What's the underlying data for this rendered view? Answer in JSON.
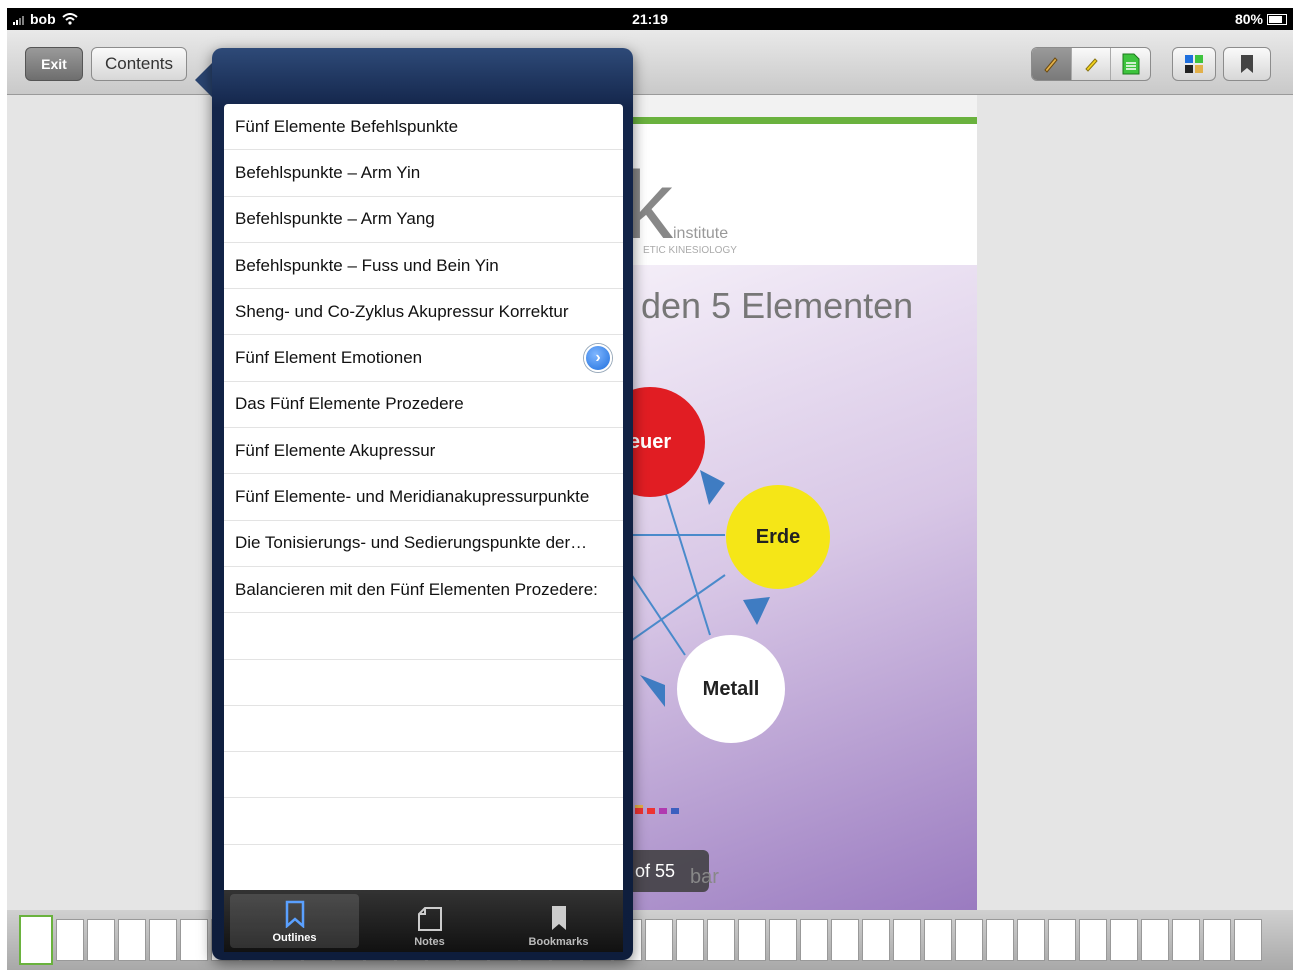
{
  "status_bar": {
    "carrier": "bob",
    "time": "21:19",
    "battery": "80%"
  },
  "toolbar": {
    "exit_label": "Exit",
    "contents_label": "Contents"
  },
  "document": {
    "logo_letter": "k",
    "logo_sub": "institute",
    "logo_tagline": "ETIC KINESIOLOGY",
    "headline": "den 5 Elementen",
    "elements": {
      "fire": "euer",
      "earth": "Erde",
      "metal": "Metall"
    },
    "page_indicator": "of 55",
    "author_fragment": "bar"
  },
  "outline": {
    "items": [
      {
        "label": "Fünf Elemente Befehlspunkte"
      },
      {
        "label": "Befehlspunkte – Arm Yin"
      },
      {
        "label": "Befehlspunkte – Arm Yang"
      },
      {
        "label": "Befehlspunkte – Fuss und Bein Yin"
      },
      {
        "label": "Sheng- und Co-Zyklus Akupressur Korrektur"
      },
      {
        "label": "Fünf Element Emotionen"
      },
      {
        "label": "Das Fünf Elemente Prozedere"
      },
      {
        "label": "Fünf Elemente Akupressur"
      },
      {
        "label": "Fünf Elemente- und Meridianakupressurpunkte"
      },
      {
        "label": "Die Tonisierungs- und Sedierungspunkte der…"
      },
      {
        "label": "Balancieren mit den Fünf Elementen Prozedere:"
      }
    ],
    "tabs": [
      {
        "label": "Outlines",
        "icon": "bookmark-outline-icon",
        "active": true
      },
      {
        "label": "Notes",
        "icon": "note-icon",
        "active": false
      },
      {
        "label": "Bookmarks",
        "icon": "bookmark-icon",
        "active": false
      }
    ]
  },
  "colors": {
    "accent_green": "#6ab23e",
    "popover_navy": "#13254a",
    "disclosure_blue": "#1e6fdd"
  }
}
